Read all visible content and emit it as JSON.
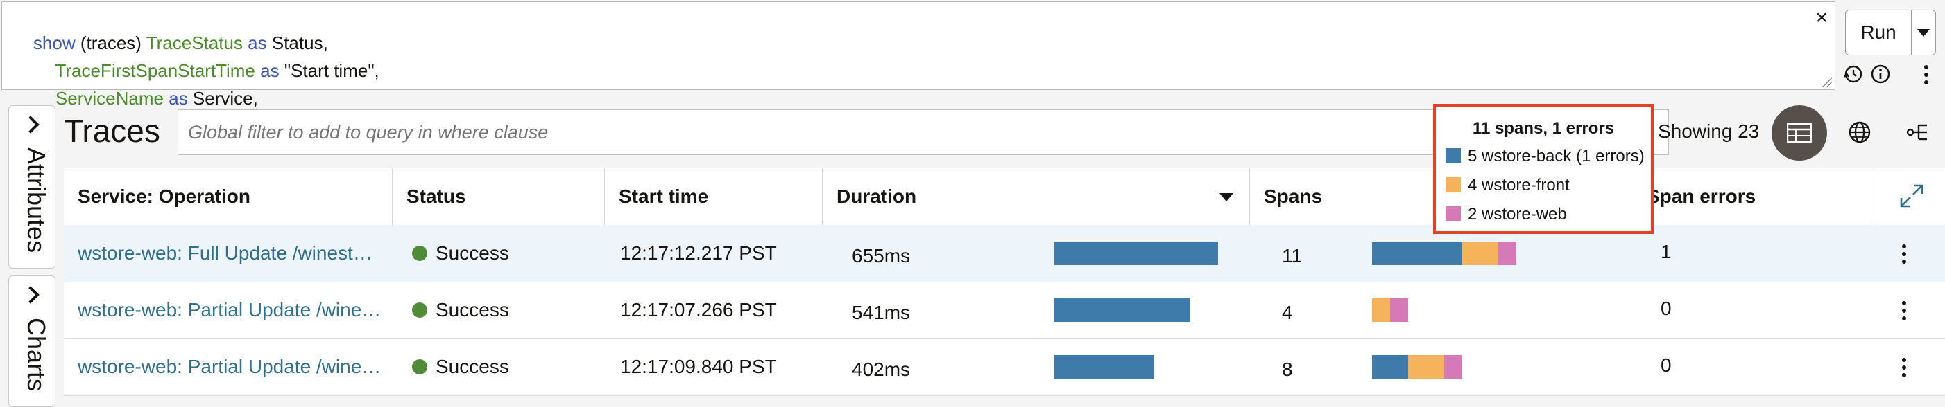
{
  "query": {
    "line1": {
      "kw1": "show",
      "p1": " (traces) ",
      "fn1": "TraceStatus",
      "kw2": " as ",
      "p2": "Status,"
    },
    "line2": {
      "fn1": "TraceFirstSpanStartTime",
      "kw1": " as ",
      "p1": "\"Start time\","
    },
    "line3": {
      "fn1": "ServiceName",
      "kw1": " as ",
      "p1": "Service,"
    },
    "close_label": "×"
  },
  "run_label": "Run",
  "side_tabs": {
    "attributes": "Attributes",
    "charts": "Charts"
  },
  "traces": {
    "title": "Traces",
    "filter_placeholder": "Global filter to add to query in where clause",
    "showing": "Showing 23"
  },
  "table": {
    "headers": [
      "Service: Operation",
      "Status",
      "Start time",
      "Duration",
      "Spans",
      "Span errors"
    ],
    "rows": [
      {
        "operation": "wstore-web: Full Update /winestore-web/...",
        "status": "Success",
        "start": "12:17:12.217 PST",
        "duration": "655ms",
        "duration_fraction": 1.0,
        "spans": "11",
        "span_mix": [
          5,
          2,
          1
        ],
        "errors": "1"
      },
      {
        "operation": "wstore-web: Partial Update /winestore-web/...",
        "status": "Success",
        "start": "12:17:07.266 PST",
        "duration": "541ms",
        "duration_fraction": 0.83,
        "spans": "4",
        "span_mix": [
          0,
          1,
          1
        ],
        "errors": "0"
      },
      {
        "operation": "wstore-web: Partial Update /winestore-web/...",
        "status": "Success",
        "start": "12:17:09.840 PST",
        "duration": "402ms",
        "duration_fraction": 0.61,
        "spans": "8",
        "span_mix": [
          2,
          2,
          1
        ],
        "errors": "0"
      }
    ]
  },
  "popup": {
    "title": "11 spans, 1 errors",
    "items": [
      {
        "label": "5 wstore-back (1 errors)",
        "color": "#3e7aaa"
      },
      {
        "label": "4 wstore-front",
        "color": "#f5b35c"
      },
      {
        "label": "2 wstore-web",
        "color": "#d67ab7"
      }
    ]
  },
  "colors": {
    "accent": "#3e7aaa",
    "front": "#f5b35c",
    "web": "#d67ab7",
    "success": "#508c37",
    "highlight": "#e0432a"
  }
}
